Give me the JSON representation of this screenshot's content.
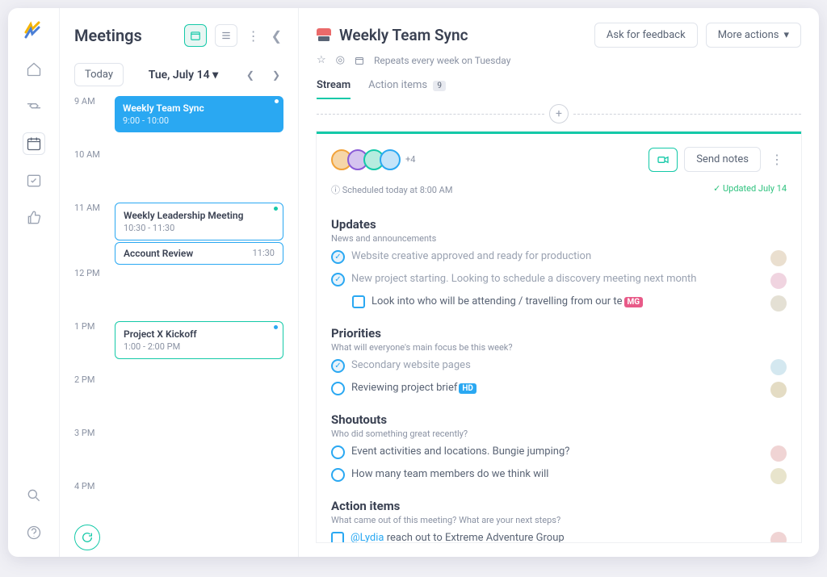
{
  "page_title": "Meetings",
  "today_label": "Today",
  "date_label": "Tue, July 14",
  "hours": [
    "9 AM",
    "10 AM",
    "11 AM",
    "12 PM",
    "1 PM",
    "2 PM",
    "3 PM",
    "4 PM"
  ],
  "events": {
    "e0": {
      "title": "Weekly Team Sync",
      "time": "9:00 - 10:00"
    },
    "e1": {
      "title": "Weekly Leadership Meeting",
      "time": "10:30 - 11:30"
    },
    "e2": {
      "title": "Account Review",
      "time_right": "11:30"
    },
    "e3": {
      "title": "Project X Kickoff",
      "time": "1:00 - 2:00 PM"
    }
  },
  "detail": {
    "title": "Weekly Team Sync",
    "repeats": "Repeats every week on Tuesday",
    "ask_feedback": "Ask for feedback",
    "more_actions": "More actions",
    "tabs": {
      "stream": "Stream",
      "action_items": "Action items",
      "action_count": "9"
    },
    "avatars_more": "+4",
    "send_notes": "Send notes",
    "scheduled": "Scheduled today at 8:00 AM",
    "updated": "Updated July 14"
  },
  "sections": {
    "updates": {
      "title": "Updates",
      "sub": "News and announcements"
    },
    "priorities": {
      "title": "Priorities",
      "sub": "What will everyone's main focus be this week?"
    },
    "shoutouts": {
      "title": "Shoutouts",
      "sub": "Who did something great recently?"
    },
    "action_items": {
      "title": "Action items",
      "sub": "What came out of this meeting? What are your next steps?"
    }
  },
  "items": {
    "u1": "Website creative approved and ready for production",
    "u2": "New project starting. Looking to schedule a discovery meeting next month",
    "u3a": "Look into who will be attending / travelling from our te",
    "u3chip": "MG",
    "p1": "Secondary website pages",
    "p2": "Reviewing project brief",
    "p2chip": "HD",
    "s1": "Event activities and locations. Bungie jumping?",
    "s2": "How many team members do we think will",
    "a1_mention": "@Lydia",
    "a1_rest": " reach out to Extreme Adventure Group"
  }
}
